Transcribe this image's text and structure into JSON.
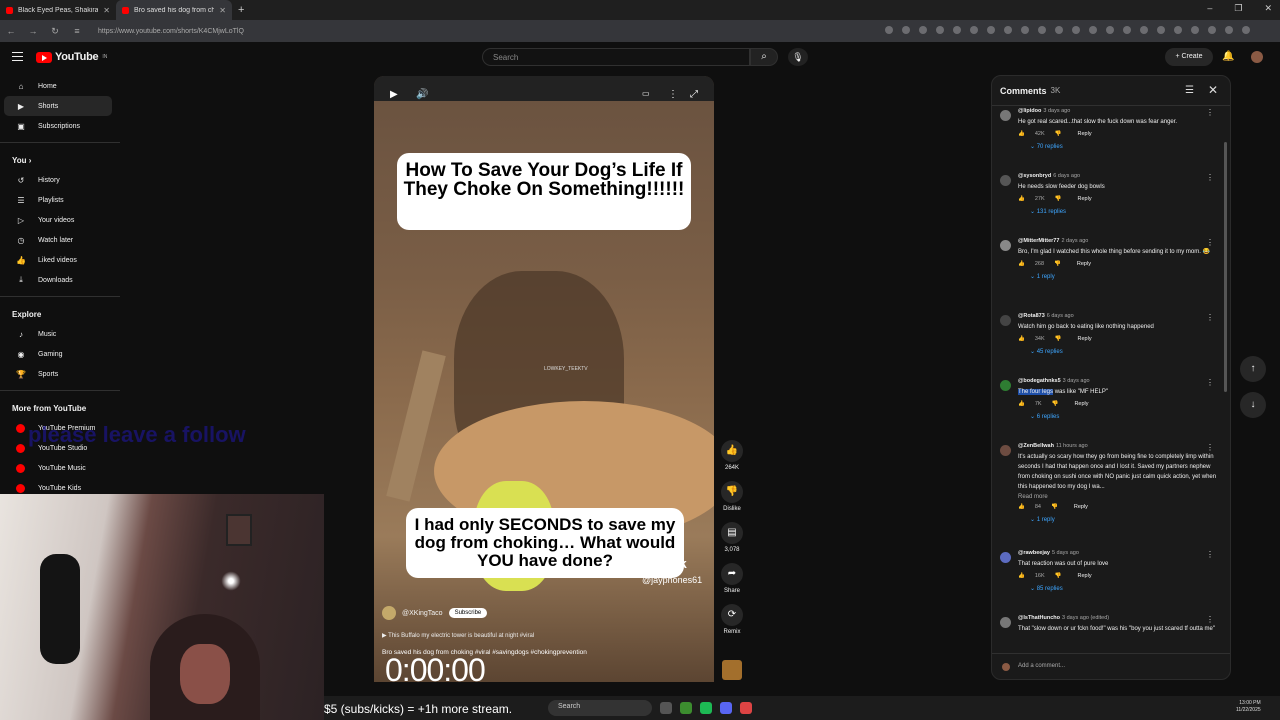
{
  "browser": {
    "tabs": [
      {
        "title": "Black Eyed Peas, Shakira - GIRL",
        "active": false
      },
      {
        "title": "Bro saved his dog from choking",
        "active": true
      }
    ],
    "new_tab": "+",
    "url": "https://www.youtube.com/shorts/K4CMjwLoTlQ",
    "win_min": "–",
    "win_max": "❐",
    "win_close": "✕"
  },
  "header": {
    "logo_text": "YouTube",
    "logo_sup": "IN",
    "search_placeholder": "Search",
    "create_label": "+ Create"
  },
  "sidebar": {
    "main": [
      {
        "label": "Home",
        "icon": "⌂",
        "active": false
      },
      {
        "label": "Shorts",
        "icon": "▶",
        "active": true
      },
      {
        "label": "Subscriptions",
        "icon": "▣",
        "active": false
      }
    ],
    "you_label": "You ›",
    "you_items": [
      {
        "label": "History",
        "icon": "↺"
      },
      {
        "label": "Playlists",
        "icon": "☰"
      },
      {
        "label": "Your videos",
        "icon": "▷"
      },
      {
        "label": "Watch later",
        "icon": "◷"
      },
      {
        "label": "Liked videos",
        "icon": "👍"
      },
      {
        "label": "Downloads",
        "icon": "⤓"
      }
    ],
    "explore_label": "Explore",
    "explore_items": [
      {
        "label": "Music",
        "icon": "♪"
      },
      {
        "label": "Gaming",
        "icon": "◉"
      },
      {
        "label": "Sports",
        "icon": "🏆"
      }
    ],
    "more_label": "More from YouTube",
    "more_items": [
      {
        "label": "YouTube Premium"
      },
      {
        "label": "YouTube Studio"
      },
      {
        "label": "YouTube Music"
      },
      {
        "label": "YouTube Kids"
      }
    ]
  },
  "overlay_follow": "please leave a follow",
  "video": {
    "caption_top": "How To Save Your Dog’s Life If They Choke On Something!!!!!!",
    "caption_bottom": "I had only SECONDS to save my dog from choking… What would YOU have done?",
    "watermark": "LOWKEY_TEEKTV",
    "tiktok": "TikTok",
    "tiktok_user": "@jayphones61",
    "channel": "@XKingTaco",
    "subscribe": "Subscribe",
    "music": "▶  This Buffalo my electric tower is beautiful at night #viral",
    "title": "Bro saved his dog from choking #viral #savingdogs #chokingprevention",
    "timer": "0:00:00"
  },
  "actions": {
    "like_count": "264K",
    "dislike_label": "Dislike",
    "comments_count": "3,078",
    "share_label": "Share",
    "remix_label": "Remix"
  },
  "comments": {
    "title": "Comments",
    "count": "3K",
    "add_placeholder": "Add a comment...",
    "reply_label": "Reply",
    "items": [
      {
        "user": "@lipidoo",
        "ago": "3 days ago",
        "text": "He got real scared...that slow the fuck down was fear anger.",
        "likes": "42K",
        "replies": "70 replies",
        "more": ""
      },
      {
        "user": "@sysonbryd",
        "ago": "6 days ago",
        "text": "He needs slow feeder dog bowls",
        "likes": "27K",
        "replies": "131 replies",
        "more": ""
      },
      {
        "user": "@MitterMitter77",
        "ago": "2 days ago",
        "text": "Bro, I'm glad I watched this whole thing before sending it to my mom. 😂",
        "likes": "268",
        "replies": "1 reply",
        "more": ""
      },
      {
        "user": "@Rota873",
        "ago": "6 days ago",
        "text": "Watch him go back to eating like nothing happened",
        "likes": "34K",
        "replies": "45 replies",
        "more": ""
      },
      {
        "user": "@bodegathnks5",
        "ago": "3 days ago",
        "text": "The four legs was like \"MF HELP\"",
        "likes": "7K",
        "replies": "6 replies",
        "more": ""
      },
      {
        "user": "@ZenBellwah",
        "ago": "11 hours ago",
        "text": "It's actually so scary how they go from being fine to completely limp within seconds I had that happen once and I lost it. Saved my partners nephew from choking on sushi once with NO panic just calm quick action, yet when this happened too my dog I wa...",
        "likes": "84",
        "replies": "1 reply",
        "more": "Read more"
      },
      {
        "user": "@rawbeejay",
        "ago": "5 days ago",
        "text": "That reaction was out of pure love",
        "likes": "16K",
        "replies": "85 replies",
        "more": ""
      },
      {
        "user": "@IsThatHuncho",
        "ago": "3 days ago (edited)",
        "text": "That \"slow down or ur fckn food!\" was his \"boy you just scared tf outta me\"",
        "likes": "",
        "replies": "",
        "more": ""
      }
    ]
  },
  "taskbar": {
    "stream_text": "$5 (subs/kicks) = +1h more stream.",
    "search": "Search",
    "time": "13:00 PM",
    "date": "11/22/2025"
  }
}
